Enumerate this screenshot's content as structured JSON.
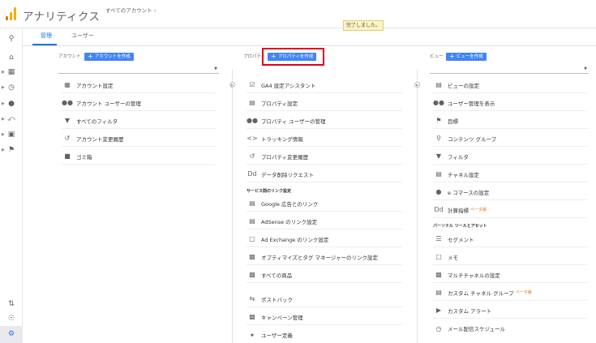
{
  "header": {
    "app_title": "アナリティクス",
    "account_crumb": "すべてのアカウント ›"
  },
  "toast": "完了しました。",
  "tabs": [
    {
      "label": "管理"
    },
    {
      "label": "ユーザー"
    }
  ],
  "account": {
    "header": "アカウント",
    "create_button": "アカウントを作成",
    "items": [
      {
        "label": "アカウント設定"
      },
      {
        "label": "アカウント ユーザーの管理"
      },
      {
        "label": "すべてのフィルタ"
      },
      {
        "label": "アカウント変更履歴"
      },
      {
        "label": "ゴミ箱"
      }
    ]
  },
  "property": {
    "header": "プロパティ",
    "create_button": "プロパティを作成",
    "items": [
      {
        "label": "GA4 設定アシスタント"
      },
      {
        "label": "プロパティ設定"
      },
      {
        "label": "プロパティ ユーザーの管理"
      },
      {
        "label": "トラッキング情報"
      },
      {
        "label": "プロパティ変更履歴"
      },
      {
        "label": "データ削除リクエスト"
      }
    ],
    "section_title": "サービス間のリンク設定",
    "link_items": [
      {
        "label": "Google 広告とのリンク"
      },
      {
        "label": "AdSense のリンク設定"
      },
      {
        "label": "Ad Exchange のリンク設定"
      },
      {
        "label": "オプティマイズとタグ マネージャーのリンク設定"
      },
      {
        "label": "すべての商品"
      }
    ],
    "more_items": [
      {
        "label": "ポストバック"
      },
      {
        "label": "キャンペーン管理"
      },
      {
        "label": "ユーザー定義"
      }
    ]
  },
  "view": {
    "header": "ビュー",
    "create_button": "ビューを作成",
    "items": [
      {
        "label": "ビューの設定"
      },
      {
        "label": "ユーザー管理を表示"
      },
      {
        "label": "目標"
      },
      {
        "label": "コンテンツ グループ"
      },
      {
        "label": "フィルタ"
      },
      {
        "label": "チャネル設定"
      },
      {
        "label": "e コマースの設定"
      },
      {
        "label": "計算指標",
        "badge": "ベータ版"
      }
    ],
    "section_title": "パーソナル ツールとアセット",
    "personal_items": [
      {
        "label": "セグメント"
      },
      {
        "label": "メモ"
      },
      {
        "label": "マルチチャネルの設定"
      },
      {
        "label": "カスタム チャネル グループ",
        "badge": "ベータ版"
      },
      {
        "label": "カスタム アラート"
      },
      {
        "label": "メール配信スケジュール"
      }
    ]
  },
  "colors": {
    "accent": "#4285f4",
    "highlight": "#e3001b",
    "logo_orange": "#f9ab00"
  }
}
